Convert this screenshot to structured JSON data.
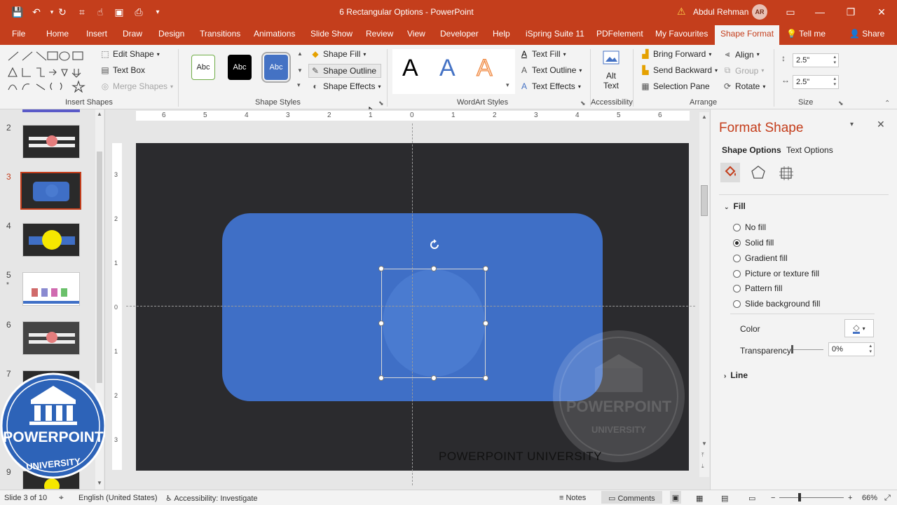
{
  "app": {
    "document_title": "6 Rectangular Options",
    "app_name": "PowerPoint",
    "title_separator": "-",
    "user_name": "Abdul Rehman",
    "user_initials": "AR"
  },
  "tabs": [
    {
      "label": "File"
    },
    {
      "label": "Home"
    },
    {
      "label": "Insert"
    },
    {
      "label": "Draw"
    },
    {
      "label": "Design"
    },
    {
      "label": "Transitions"
    },
    {
      "label": "Animations"
    },
    {
      "label": "Slide Show"
    },
    {
      "label": "Review"
    },
    {
      "label": "View"
    },
    {
      "label": "Developer"
    },
    {
      "label": "Help"
    },
    {
      "label": "iSpring Suite 11"
    },
    {
      "label": "PDFelement"
    },
    {
      "label": "My Favourites"
    },
    {
      "label": "Shape Format"
    },
    {
      "label": "Tell me"
    },
    {
      "label": "Share"
    }
  ],
  "ribbon": {
    "insert_shapes": {
      "label": "Insert Shapes",
      "edit_shape": "Edit Shape",
      "text_box": "Text Box",
      "merge_shapes": "Merge Shapes"
    },
    "shape_styles": {
      "label": "Shape Styles",
      "thumb_text": "Abc",
      "shape_fill": "Shape Fill",
      "shape_outline": "Shape Outline",
      "shape_effects": "Shape Effects"
    },
    "wordart_styles": {
      "label": "WordArt Styles",
      "letter": "A",
      "text_fill": "Text Fill",
      "text_outline": "Text Outline",
      "text_effects": "Text Effects"
    },
    "accessibility": {
      "label": "Accessibility",
      "alt_text_1": "Alt",
      "alt_text_2": "Text"
    },
    "arrange": {
      "label": "Arrange",
      "bring_forward": "Bring Forward",
      "send_backward": "Send Backward",
      "selection_pane": "Selection Pane",
      "align": "Align",
      "group": "Group",
      "rotate": "Rotate"
    },
    "size": {
      "label": "Size",
      "height": "2.5\"",
      "width": "2.5\""
    }
  },
  "ruler": {
    "h_ticks": [
      "6",
      "5",
      "4",
      "3",
      "2",
      "1",
      "0",
      "1",
      "2",
      "3",
      "4",
      "5",
      "6"
    ],
    "v_ticks": [
      "3",
      "2",
      "1",
      "0",
      "1",
      "2",
      "3"
    ]
  },
  "slides": [
    {
      "num": "2"
    },
    {
      "num": "3"
    },
    {
      "num": "4"
    },
    {
      "num": "5",
      "star": "*"
    },
    {
      "num": "6"
    },
    {
      "num": "7"
    },
    {
      "num": "9"
    }
  ],
  "watermark": {
    "line1": "POWERPOINT",
    "line2": "UNIVERSITY"
  },
  "slide_footer_text": "POWERPOINT UNIVERSITY",
  "format_pane": {
    "title": "Format Shape",
    "tab_shape_options": "Shape Options",
    "tab_text_options": "Text Options",
    "fill_section": "Fill",
    "fill_options": [
      {
        "label": "No fill",
        "selected": false
      },
      {
        "label": "Solid fill",
        "selected": true
      },
      {
        "label": "Gradient fill",
        "selected": false
      },
      {
        "label": "Picture or texture fill",
        "selected": false
      },
      {
        "label": "Pattern fill",
        "selected": false
      },
      {
        "label": "Slide background fill",
        "selected": false
      }
    ],
    "color_label": "Color",
    "transparency_label": "Transparency",
    "transparency_value": "0%",
    "line_section": "Line"
  },
  "status": {
    "slide_info": "Slide 3 of 10",
    "language": "English (United States)",
    "accessibility": "Accessibility: Investigate",
    "notes": "Notes",
    "comments": "Comments",
    "zoom": "66%"
  },
  "colors": {
    "accent": "#c43e1c",
    "shape_blue": "#3f6fc6",
    "slide_bg": "#2b2b2e"
  }
}
